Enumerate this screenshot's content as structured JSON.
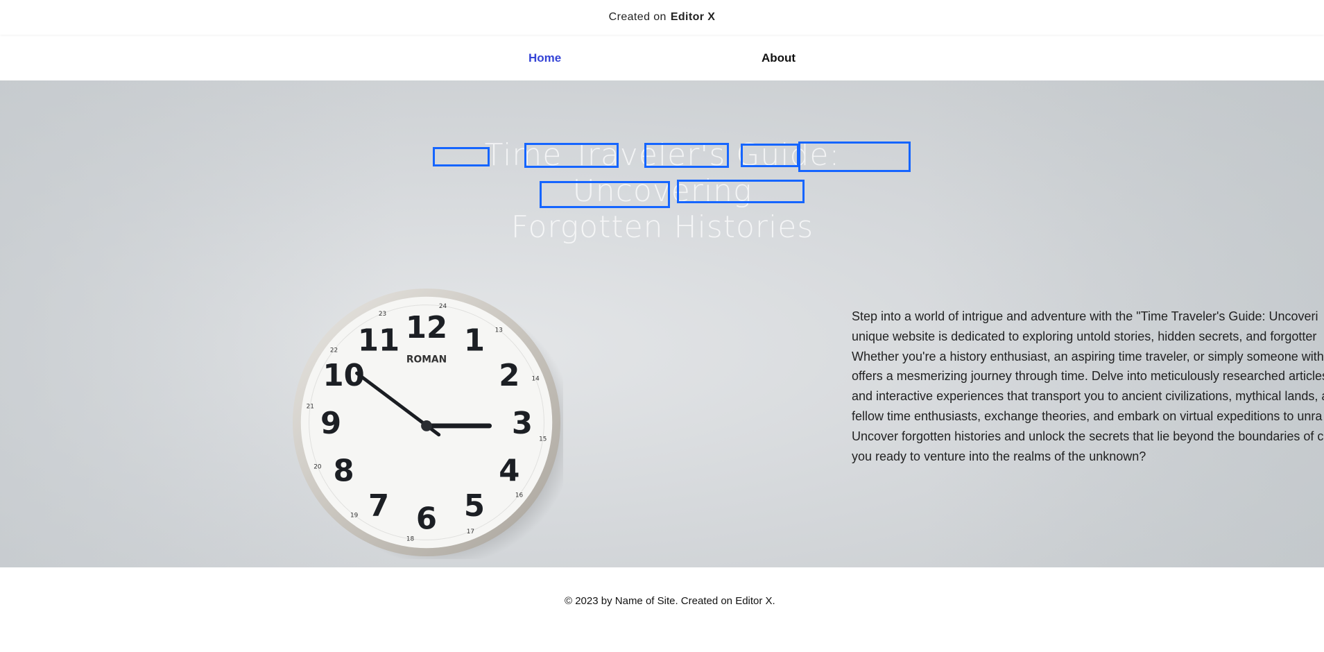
{
  "banner": {
    "prefix": "Created on",
    "brand": "Editor X"
  },
  "nav": {
    "home": "Home",
    "about": "About",
    "active_color": "#3544d6"
  },
  "hero": {
    "title_line1": "Time Traveler's Guide: Uncovering",
    "title_line2": "Forgotten Histories",
    "description_lines": [
      "Step into a world of intrigue and adventure with the \"Time Traveler's Guide: Uncoveri",
      "unique website is dedicated to exploring untold stories, hidden secrets, and forgotter",
      "Whether you're a history enthusiast, an aspiring time traveler, or simply someone with",
      "offers a mesmerizing journey through time. Delve into meticulously researched articles",
      "and interactive experiences that transport you to ancient civilizations, mythical lands, a",
      "fellow time enthusiasts, exchange theories, and embark on virtual expeditions to unra",
      "Uncover forgotten histories and unlock the secrets that lie beyond the boundaries of c",
      "you ready to venture into the realms of the unknown?"
    ],
    "clock": {
      "brand": "ROMAN",
      "hours": [
        "12",
        "1",
        "2",
        "3",
        "4",
        "5",
        "6",
        "7",
        "8",
        "9",
        "10",
        "11"
      ],
      "minutes_labels": [
        "24",
        "13",
        "14",
        "15",
        "16",
        "17",
        "18",
        "19",
        "20",
        "21",
        "22",
        "23"
      ]
    },
    "highlight_color": "#1565ff"
  },
  "footer": {
    "text": "© 2023 by Name of Site. Created on Editor X."
  }
}
